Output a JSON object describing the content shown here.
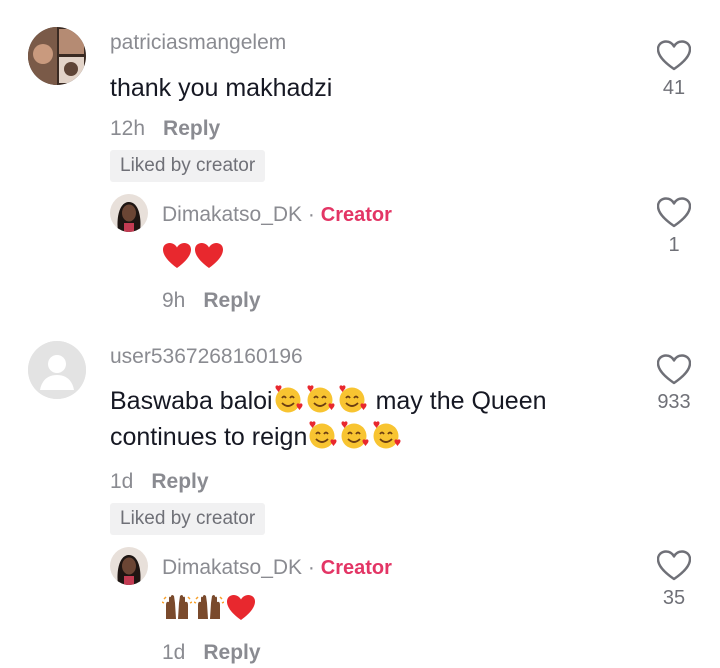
{
  "comments": [
    {
      "username": "patriciasmangelem",
      "text": "thank you makhadzi",
      "time": "12h",
      "reply_label": "Reply",
      "liked_badge": "Liked by creator",
      "likes": "41",
      "icon": "heart-outline-icon"
    },
    {
      "username": "user5367268160196",
      "text_line1": "Baswaba baloi",
      "text_line1b": "may the Queen",
      "text_line2": "continues to reign",
      "time": "1d",
      "reply_label": "Reply",
      "liked_badge": "Liked by creator",
      "likes": "933",
      "icon": "heart-outline-icon"
    }
  ],
  "replies": [
    {
      "username": "Dimakatso_DK",
      "separator": "·",
      "creator_label": "Creator",
      "time": "9h",
      "reply_label": "Reply",
      "likes": "1",
      "emojis": [
        "red-heart",
        "red-heart"
      ]
    },
    {
      "username": "Dimakatso_DK",
      "separator": "·",
      "creator_label": "Creator",
      "time": "1d",
      "reply_label": "Reply",
      "likes": "35",
      "emojis": [
        "raising-hands",
        "raising-hands",
        "red-heart"
      ]
    }
  ],
  "colors": {
    "creator_accent": "#e33565",
    "muted_text": "#8a8b91",
    "badge_bg": "#f1f1f2"
  }
}
